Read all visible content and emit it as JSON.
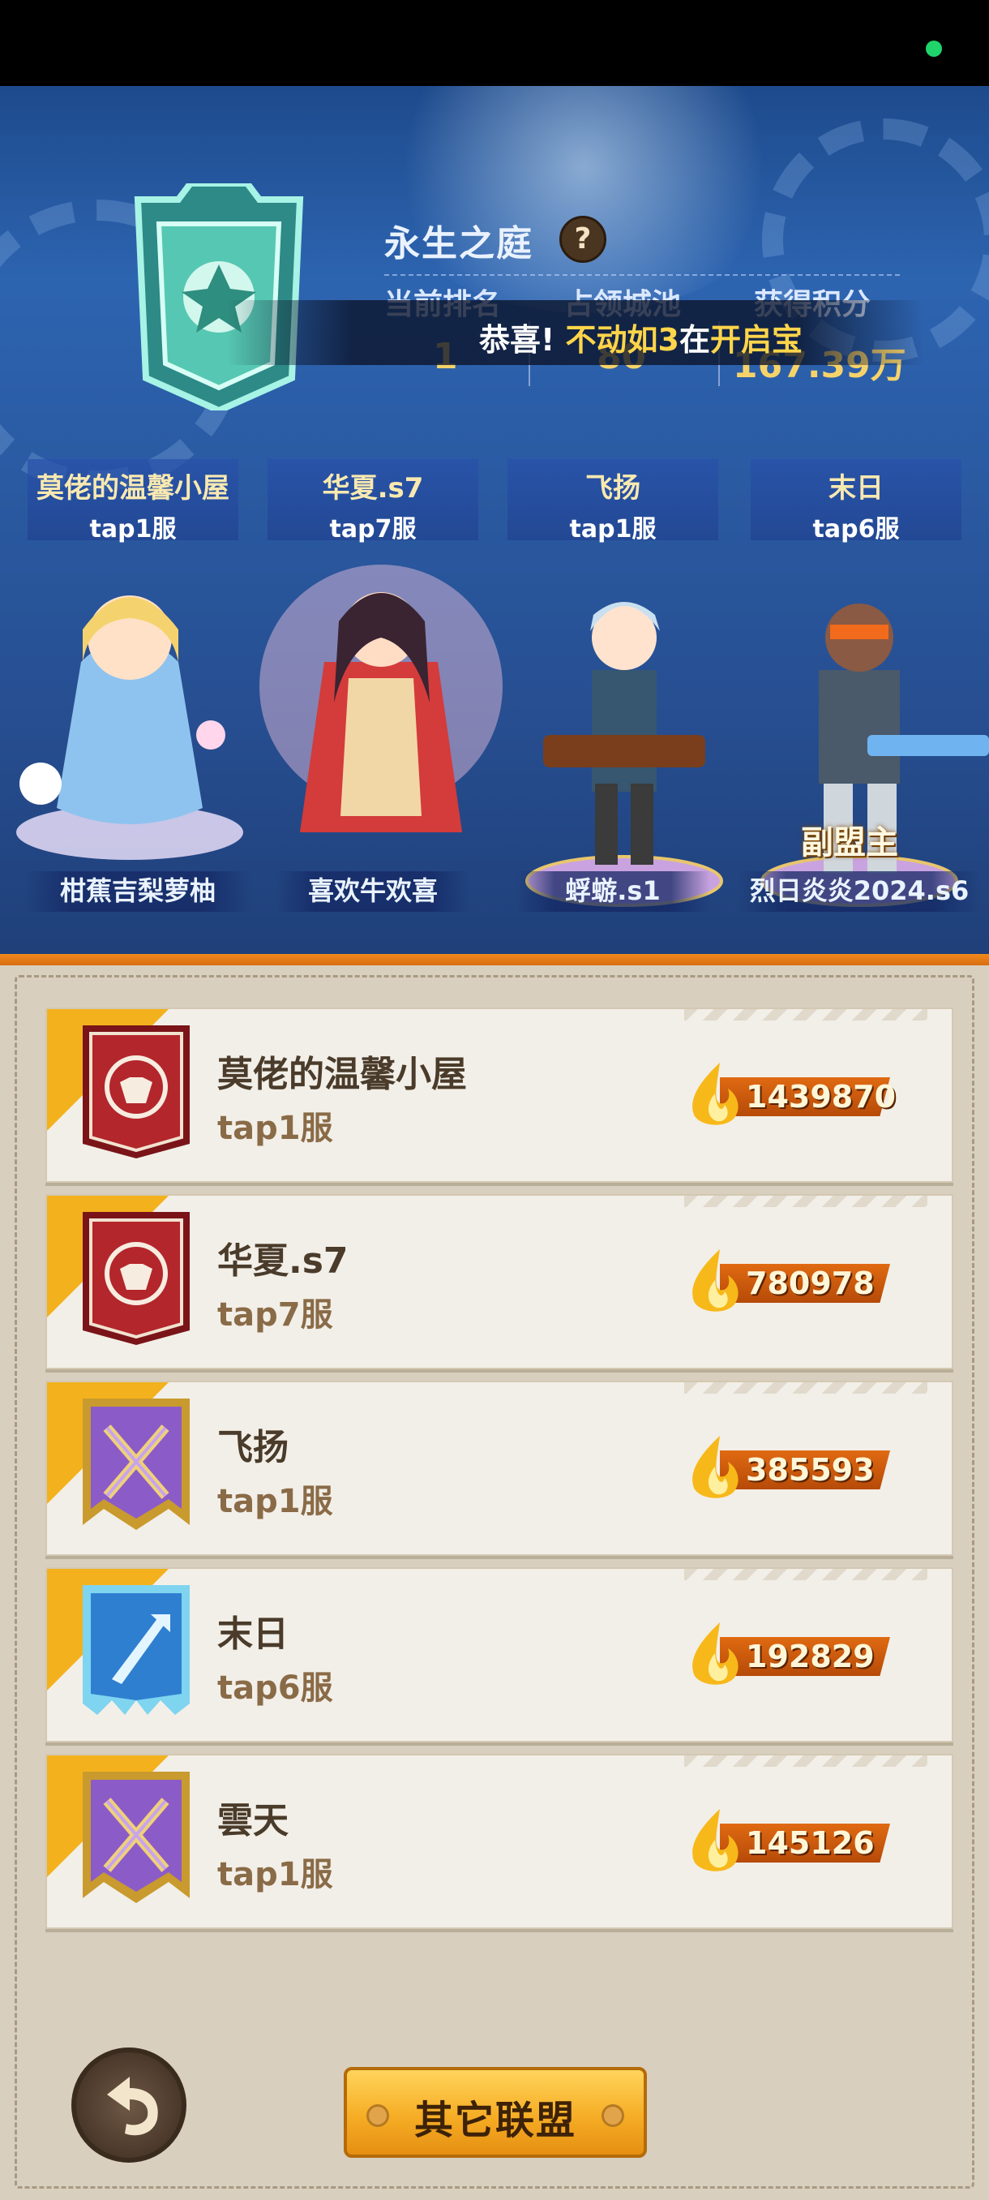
{
  "header": {
    "domain_title": "永生之庭",
    "help_label": "?",
    "stats": [
      {
        "label": "当前排名",
        "value": "1"
      },
      {
        "label": "占领城池",
        "value": "80"
      },
      {
        "label": "获得积分",
        "value": "167.39万"
      }
    ],
    "announcement": {
      "prefix": "恭喜!",
      "player": "不动如3",
      "mid": "在",
      "action": "开启宝"
    }
  },
  "alliance_tabs": [
    {
      "name": "莫佬的温馨小屋",
      "server": "tap1服"
    },
    {
      "name": "华夏.s7",
      "server": "tap7服"
    },
    {
      "name": "飞扬",
      "server": "tap1服"
    },
    {
      "name": "末日",
      "server": "tap6服"
    }
  ],
  "heroes": [
    {
      "player": "柑蕉吉梨萝柚",
      "role": ""
    },
    {
      "player": "喜欢牛欢喜",
      "role": ""
    },
    {
      "player": "蜉蝣.s1",
      "role": ""
    },
    {
      "player": "烈日炎炎2024.s6",
      "role": "副盟主"
    }
  ],
  "rankings": [
    {
      "name": "莫佬的温馨小屋",
      "server": "tap1服",
      "score": "1439870",
      "badge": "lion-banner-icon",
      "badge_color": "#b3262b"
    },
    {
      "name": "华夏.s7",
      "server": "tap7服",
      "score": "780978",
      "badge": "lion-banner-icon",
      "badge_color": "#b3262b"
    },
    {
      "name": "飞扬",
      "server": "tap1服",
      "score": "385593",
      "badge": "crossed-guns-banner-icon",
      "badge_color": "#8b5cc7"
    },
    {
      "name": "末日",
      "server": "tap6服",
      "score": "192829",
      "badge": "blade-banner-icon",
      "badge_color": "#2f7fd0"
    },
    {
      "name": "雲天",
      "server": "tap1服",
      "score": "145126",
      "badge": "crossed-guns-banner-icon",
      "badge_color": "#8b5cc7"
    }
  ],
  "buttons": {
    "other_alliances": "其它联盟",
    "back_icon": "undo-arrow-icon"
  },
  "colors": {
    "accent_orange": "#f18a1c",
    "gold": "#f6d36a",
    "panel_bg": "#d9cfbf"
  }
}
